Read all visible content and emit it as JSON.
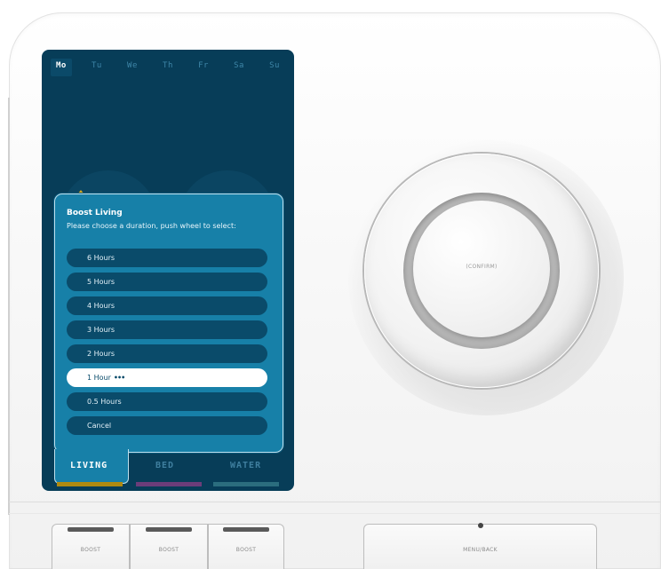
{
  "screen": {
    "days": [
      "Mo",
      "Tu",
      "We",
      "Th",
      "Fr",
      "Sa",
      "Su"
    ],
    "active_day": "Mo",
    "popup": {
      "title": "Boost Living",
      "subtitle": "Please choose a duration, push wheel to select:",
      "options": [
        {
          "label": "6 Hours",
          "selected": false
        },
        {
          "label": "5 Hours",
          "selected": false
        },
        {
          "label": "4 Hours",
          "selected": false
        },
        {
          "label": "3 Hours",
          "selected": false
        },
        {
          "label": "2 Hours",
          "selected": false
        },
        {
          "label": "1 Hour",
          "selected": true,
          "indicator": "•••"
        },
        {
          "label": "0.5 Hours",
          "selected": false
        },
        {
          "label": "Cancel",
          "selected": false
        }
      ]
    },
    "tabs": [
      {
        "label": "LIVING",
        "active": true,
        "color": "#b08a10"
      },
      {
        "label": "BED",
        "active": false,
        "color": "#6b3d7a"
      },
      {
        "label": "WATER",
        "active": false,
        "color": "#2b6d7e"
      }
    ]
  },
  "dial": {
    "label": "(CONFIRM)"
  },
  "buttons": {
    "boost_1": "BOOST",
    "boost_2": "BOOST",
    "boost_3": "BOOST",
    "menu_back": "MENU/BACK"
  },
  "colors": {
    "screen_bg": "#073d58",
    "popup_bg": "#1780a8",
    "option_bg": "#0a4b6a",
    "accent_yellow": "#d9a81c"
  }
}
